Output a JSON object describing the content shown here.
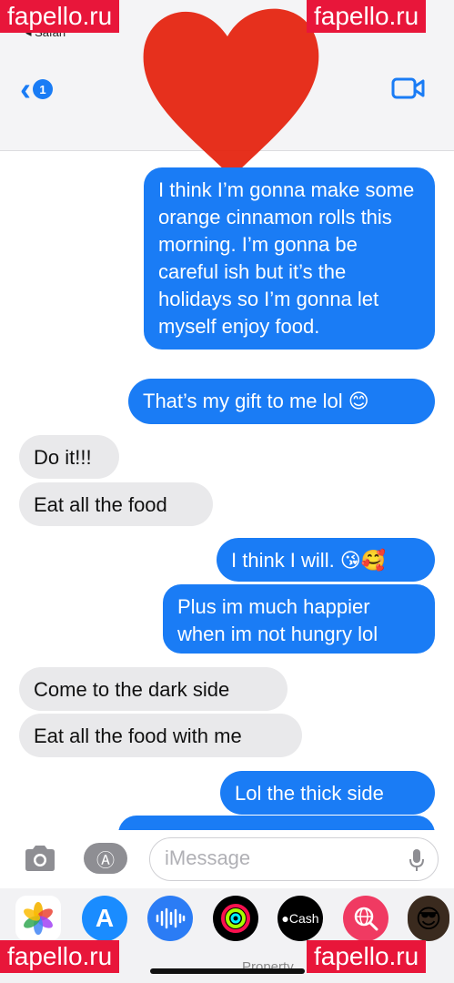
{
  "status_bar": {
    "back_app": "◂ Safari"
  },
  "nav": {
    "unread_count": "1",
    "video_icon": "video-camera-icon"
  },
  "watermark": {
    "text": "fapello.ru",
    "bg": "#e8163a"
  },
  "messages": [
    {
      "dir": "out",
      "text": "I think I’m gonna make some orange cinnamon rolls this morning. I’m gonna be careful ish but it’s the holidays so I’m gonna let myself enjoy food."
    },
    {
      "dir": "out",
      "text": "That’s my gift to me lol 😊"
    },
    {
      "dir": "in",
      "text": "Do it!!!"
    },
    {
      "dir": "in",
      "text": "Eat all the food"
    },
    {
      "dir": "out",
      "text": "I think I will. 😘🥰"
    },
    {
      "dir": "out",
      "text": "Plus im much happier when im not hungry lol"
    },
    {
      "dir": "in",
      "text": "Come to the dark side"
    },
    {
      "dir": "in",
      "text": "Eat all the food with me"
    },
    {
      "dir": "out",
      "text": "Lol the thick side"
    }
  ],
  "composer": {
    "placeholder": "iMessage"
  },
  "tray": {
    "apps": [
      "photos-app",
      "app-store-app",
      "audio-message-app",
      "fitness-app",
      "apple-cash-app",
      "image-search-app",
      "memoji-app"
    ],
    "cash_label": "Cash"
  },
  "footer": {
    "text": "Property"
  },
  "colors": {
    "outgoing": "#1a7cf5",
    "incoming": "#e9e9eb",
    "accent": "#1a7cf5"
  }
}
